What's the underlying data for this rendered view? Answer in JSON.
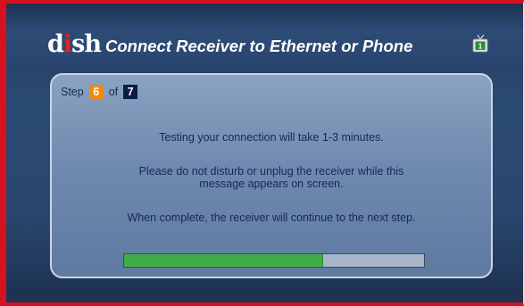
{
  "header": {
    "logo": {
      "pre": "d",
      "dot": "i",
      "post": "sh"
    },
    "title": "Connect Receiver to Ethernet or Phone",
    "tv_icon": {
      "name": "tv-icon",
      "channel": "1"
    }
  },
  "step": {
    "label": "Step",
    "current": "6",
    "of_label": "of",
    "total": "7"
  },
  "messages": {
    "line1": "Testing your connection will take 1-3 minutes.",
    "line2a": "Please do not disturb or unplug the receiver while this",
    "line2b": "message appears on screen.",
    "line3": "When complete, the receiver will continue to the next step."
  },
  "progress": {
    "fraction": 0.66
  },
  "colors": {
    "border_red": "#d6121f",
    "step_current": "#f08a13",
    "step_total": "#0e1a4a",
    "progress_fill": "#41ad49"
  }
}
